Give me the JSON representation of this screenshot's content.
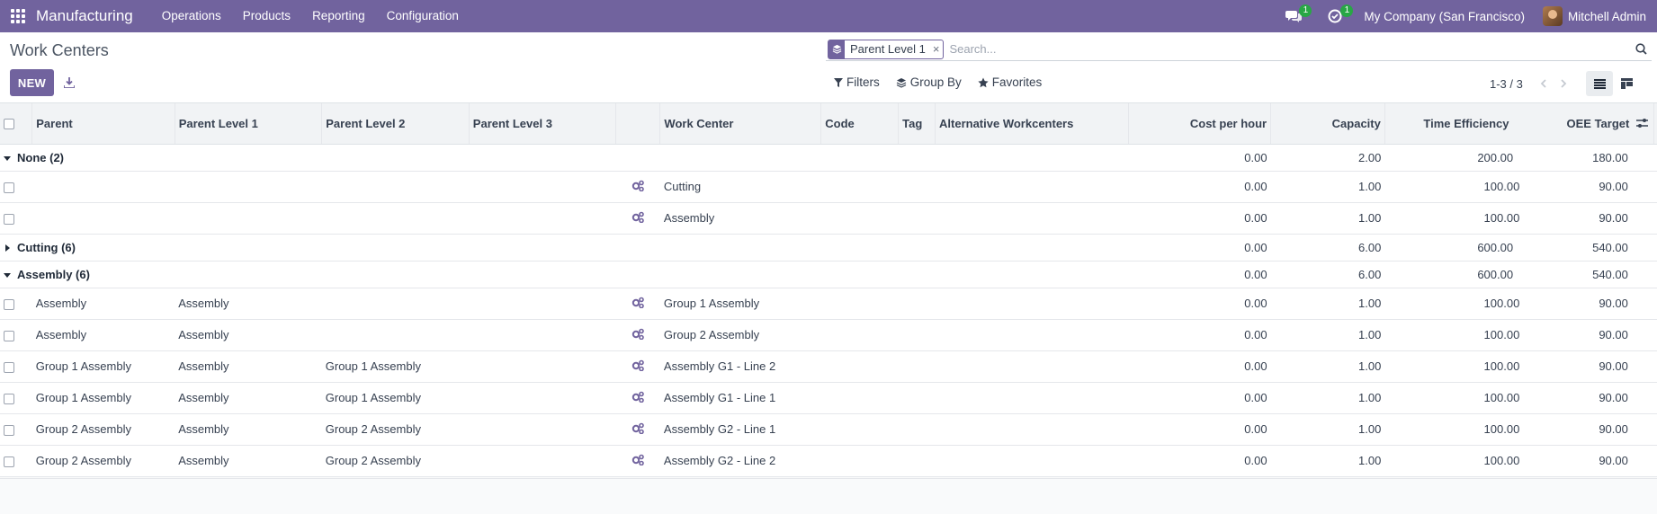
{
  "navbar": {
    "app_name": "Manufacturing",
    "menu": [
      "Operations",
      "Products",
      "Reporting",
      "Configuration"
    ],
    "messages_badge": "1",
    "activities_badge": "1",
    "company": "My Company (San Francisco)",
    "user": "Mitchell Admin"
  },
  "control_panel": {
    "title": "Work Centers",
    "new_label": "NEW",
    "search": {
      "facet_value": "Parent Level 1",
      "facet_remove": "×",
      "placeholder": "Search..."
    },
    "filters_label": "Filters",
    "group_by_label": "Group By",
    "favorites_label": "Favorites",
    "pager": "1-3 / 3"
  },
  "table": {
    "columns": [
      "Parent",
      "Parent Level 1",
      "Parent Level 2",
      "Parent Level 3",
      "",
      "Work Center",
      "Code",
      "Tag",
      "Alternative Workcenters",
      "Cost per hour",
      "Capacity",
      "Time Efficiency",
      "OEE Target"
    ],
    "groups": [
      {
        "label": "None (2)",
        "expanded": true,
        "cost": "0.00",
        "capacity": "2.00",
        "efficiency": "200.00",
        "oee": "180.00",
        "rows": [
          {
            "parent": "",
            "level1": "",
            "level2": "",
            "level3": "",
            "work_center": "Cutting",
            "code": "",
            "tag": "",
            "alternative": "",
            "cost": "0.00",
            "capacity": "1.00",
            "efficiency": "100.00",
            "oee": "90.00"
          },
          {
            "parent": "",
            "level1": "",
            "level2": "",
            "level3": "",
            "work_center": "Assembly",
            "code": "",
            "tag": "",
            "alternative": "",
            "cost": "0.00",
            "capacity": "1.00",
            "efficiency": "100.00",
            "oee": "90.00"
          }
        ]
      },
      {
        "label": "Cutting (6)",
        "expanded": false,
        "cost": "0.00",
        "capacity": "6.00",
        "efficiency": "600.00",
        "oee": "540.00",
        "rows": []
      },
      {
        "label": "Assembly (6)",
        "expanded": true,
        "cost": "0.00",
        "capacity": "6.00",
        "efficiency": "600.00",
        "oee": "540.00",
        "rows": [
          {
            "parent": "Assembly",
            "level1": "Assembly",
            "level2": "",
            "level3": "",
            "work_center": "Group 1 Assembly",
            "code": "",
            "tag": "",
            "alternative": "",
            "cost": "0.00",
            "capacity": "1.00",
            "efficiency": "100.00",
            "oee": "90.00"
          },
          {
            "parent": "Assembly",
            "level1": "Assembly",
            "level2": "",
            "level3": "",
            "work_center": "Group 2 Assembly",
            "code": "",
            "tag": "",
            "alternative": "",
            "cost": "0.00",
            "capacity": "1.00",
            "efficiency": "100.00",
            "oee": "90.00"
          },
          {
            "parent": "Group 1 Assembly",
            "level1": "Assembly",
            "level2": "Group 1 Assembly",
            "level3": "",
            "work_center": "Assembly G1 - Line 2",
            "code": "",
            "tag": "",
            "alternative": "",
            "cost": "0.00",
            "capacity": "1.00",
            "efficiency": "100.00",
            "oee": "90.00"
          },
          {
            "parent": "Group 1 Assembly",
            "level1": "Assembly",
            "level2": "Group 1 Assembly",
            "level3": "",
            "work_center": "Assembly G1 - Line 1",
            "code": "",
            "tag": "",
            "alternative": "",
            "cost": "0.00",
            "capacity": "1.00",
            "efficiency": "100.00",
            "oee": "90.00"
          },
          {
            "parent": "Group 2 Assembly",
            "level1": "Assembly",
            "level2": "Group 2 Assembly",
            "level3": "",
            "work_center": "Assembly G2 - Line 1",
            "code": "",
            "tag": "",
            "alternative": "",
            "cost": "0.00",
            "capacity": "1.00",
            "efficiency": "100.00",
            "oee": "90.00"
          },
          {
            "parent": "Group 2 Assembly",
            "level1": "Assembly",
            "level2": "Group 2 Assembly",
            "level3": "",
            "work_center": "Assembly G2 - Line 2",
            "code": "",
            "tag": "",
            "alternative": "",
            "cost": "0.00",
            "capacity": "1.00",
            "efficiency": "100.00",
            "oee": "90.00"
          }
        ]
      }
    ]
  },
  "icons": {
    "apps": "apps-grid-icon",
    "messages": "chat-bubbles-icon",
    "activities": "clock-check-icon",
    "download": "download-icon",
    "facet": "layers-icon",
    "search": "search-icon",
    "filter": "funnel-icon",
    "group_by": "layers-icon",
    "favorites": "star-icon",
    "row": "gears-icon",
    "list_view": "list-view-icon",
    "kanban_view": "kanban-view-icon",
    "optional_columns": "sliders-icon"
  },
  "colors": {
    "brand": "#71639e",
    "badge": "#28a745"
  }
}
